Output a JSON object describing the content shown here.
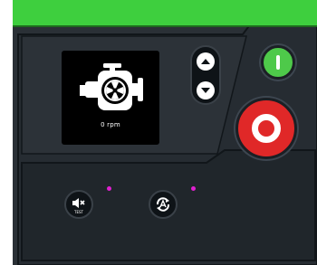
{
  "colors": {
    "panel_background": "#2a3036",
    "top_bar": "#3ecf3e",
    "start_button": "#4ec94a",
    "stop_button": "#e02828",
    "indicator_dot": "#e020d0"
  },
  "engine_display": {
    "icon": "engine-icon",
    "rpm_text": "0 rpm"
  },
  "buttons": {
    "scroll_up": "arrow-up-icon",
    "scroll_down": "arrow-down-icon",
    "start": "power-on-icon",
    "stop": "stop-ring-icon",
    "mute": "horn-mute-icon",
    "auto": "auto-restart-icon"
  },
  "mute_label": "TEST"
}
